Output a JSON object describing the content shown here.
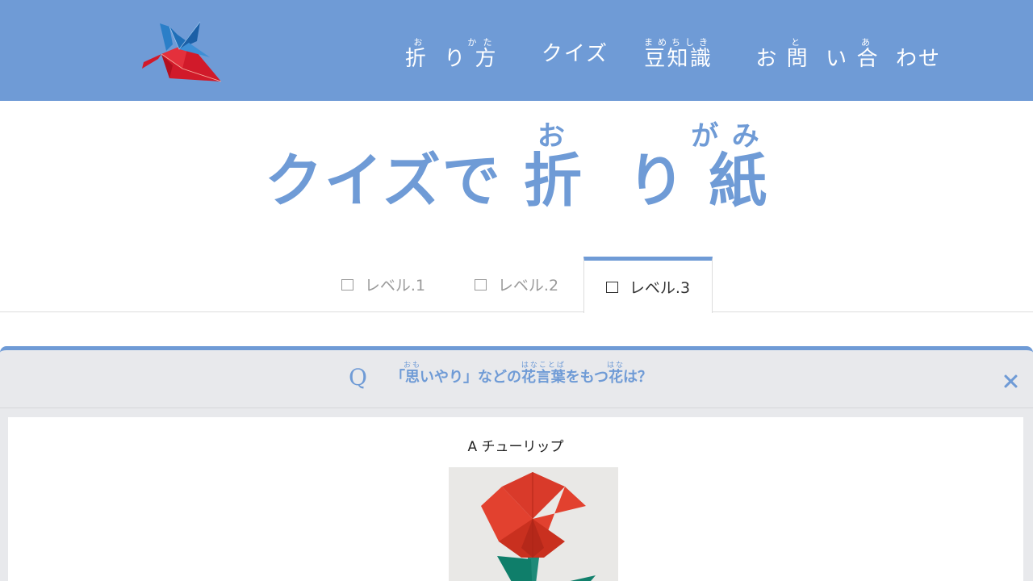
{
  "header": {
    "logo_alt": "origami crane logo",
    "nav": [
      {
        "segments": [
          {
            "base": "折",
            "ruby": "お"
          },
          {
            "base": "り",
            "ruby": ""
          },
          {
            "base": "方",
            "ruby": "かた"
          }
        ]
      },
      {
        "segments": [
          {
            "base": "クイズ",
            "ruby": ""
          }
        ]
      },
      {
        "segments": [
          {
            "base": "豆知識",
            "ruby": "まめちしき"
          }
        ]
      },
      {
        "segments": [
          {
            "base": "お",
            "ruby": ""
          },
          {
            "base": "問",
            "ruby": "と"
          },
          {
            "base": "い",
            "ruby": ""
          },
          {
            "base": "合",
            "ruby": "あ"
          },
          {
            "base": "わせ",
            "ruby": ""
          }
        ]
      }
    ]
  },
  "title": {
    "segments": [
      {
        "base": "クイズで",
        "ruby": ""
      },
      {
        "base": "折",
        "ruby": "お"
      },
      {
        "base": "り",
        "ruby": ""
      },
      {
        "base": "紙",
        "ruby": "がみ"
      }
    ]
  },
  "tabs": [
    {
      "label": "レベル.1",
      "active": false
    },
    {
      "label": "レベル.2",
      "active": false
    },
    {
      "label": "レベル.3",
      "active": true
    }
  ],
  "modal": {
    "q_mark": "Q",
    "question": [
      {
        "base": "「",
        "ruby": ""
      },
      {
        "base": "思",
        "ruby": "おも"
      },
      {
        "base": "いやり」などの",
        "ruby": ""
      },
      {
        "base": "花言葉",
        "ruby": "はなことば"
      },
      {
        "base": "をもつ",
        "ruby": ""
      },
      {
        "base": "花",
        "ruby": "はな"
      },
      {
        "base": "は？",
        "ruby": ""
      }
    ],
    "answer": "A チューリップ",
    "image_alt": "origami tulip"
  },
  "colors": {
    "accent": "#6f9bd6",
    "header_bg": "#6f9bd6",
    "modal_bg": "#e8e9ec"
  }
}
